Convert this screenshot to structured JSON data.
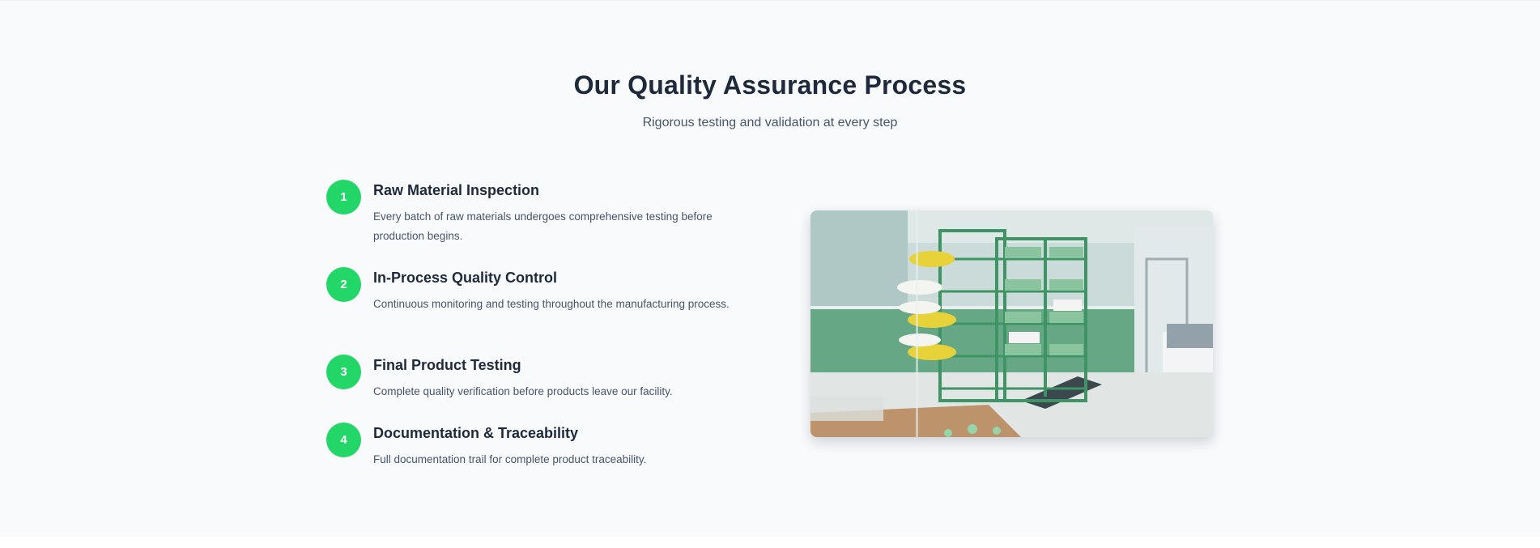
{
  "section": {
    "title": "Our Quality Assurance Process",
    "subtitle": "Rigorous testing and validation at every step"
  },
  "steps": [
    {
      "number": "1",
      "title": "Raw Material Inspection",
      "description": "Every batch of raw materials undergoes comprehensive testing before production begins."
    },
    {
      "number": "2",
      "title": "In-Process Quality Control",
      "description": "Continuous monitoring and testing throughout the manufacturing process."
    },
    {
      "number": "3",
      "title": "Final Product Testing",
      "description": "Complete quality verification before products leave our facility."
    },
    {
      "number": "4",
      "title": "Documentation & Traceability",
      "description": "Full documentation trail for complete product traceability."
    }
  ],
  "colors": {
    "accent": "#22d667",
    "heading": "#1e293b",
    "body_text": "#475569",
    "background": "#f8fafc"
  },
  "image": {
    "icon": "warehouse-photo"
  }
}
